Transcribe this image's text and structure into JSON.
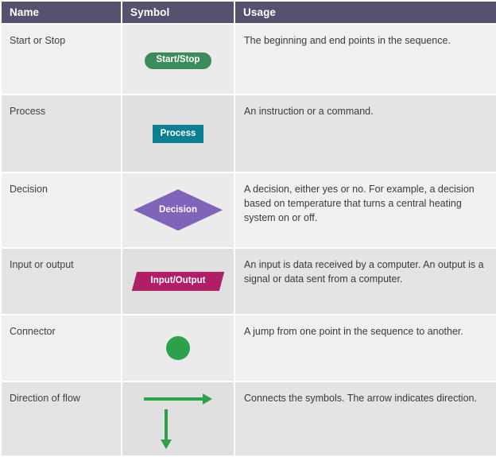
{
  "table": {
    "columns": [
      {
        "key": "name",
        "label": "Name"
      },
      {
        "key": "symbol",
        "label": "Symbol"
      },
      {
        "key": "usage",
        "label": "Usage"
      }
    ],
    "rows": [
      {
        "name": "Start or Stop",
        "symbol": {
          "type": "pill",
          "label": "Start/Stop",
          "color": "#3c8b5d"
        },
        "usage": "The beginning and end points in the sequence."
      },
      {
        "name": "Process",
        "symbol": {
          "type": "rectangle",
          "label": "Process",
          "color": "#0d7f92"
        },
        "usage": "An instruction or a command."
      },
      {
        "name": "Decision",
        "symbol": {
          "type": "diamond",
          "label": "Decision",
          "color": "#7f64b9"
        },
        "usage": "A decision, either yes or no. For example, a decision based on temperature that turns a central heating system on or off."
      },
      {
        "name": "Input or output",
        "symbol": {
          "type": "parallelogram",
          "label": "Input/Output",
          "color": "#b01e66"
        },
        "usage": "An input is data received by a computer. An output is a signal or data sent from a computer."
      },
      {
        "name": "Connector",
        "symbol": {
          "type": "circle",
          "label": "",
          "color": "#2da04c"
        },
        "usage": "A jump from one point in the sequence to another."
      },
      {
        "name": "Direction of flow",
        "symbol": {
          "type": "arrows",
          "label": "",
          "color": "#2da04c"
        },
        "usage": "Connects the symbols. The arrow indicates direction."
      }
    ]
  },
  "theme": {
    "header_background": "#54526e",
    "header_text": "#ffffff",
    "row_light": "#f0f0f0",
    "row_dark": "#e4e4e4",
    "symbol_cell_light": "#ebebeb",
    "symbol_cell_dark": "#e0e0e0",
    "body_text": "#3a3a3a"
  }
}
